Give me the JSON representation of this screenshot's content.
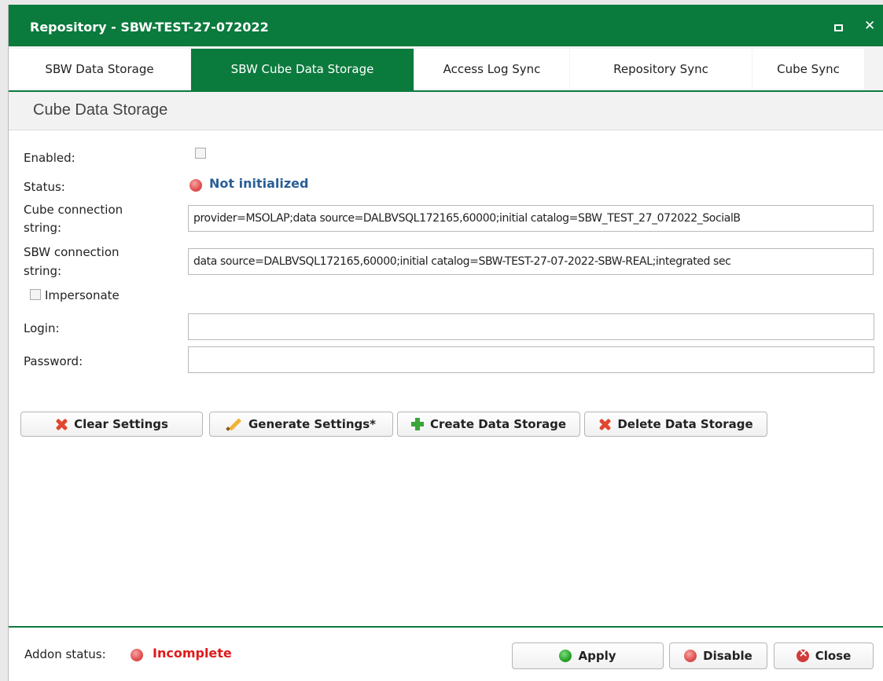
{
  "window": {
    "title": "Repository - SBW-TEST-27-072022"
  },
  "tabs": [
    {
      "label": "SBW Data Storage"
    },
    {
      "label": "SBW Cube Data Storage"
    },
    {
      "label": "Access Log Sync"
    },
    {
      "label": "Repository Sync"
    },
    {
      "label": "Cube Sync"
    }
  ],
  "section": {
    "title": "Cube Data Storage"
  },
  "form": {
    "enabled_label": "Enabled:",
    "enabled_checked": false,
    "status_label": "Status:",
    "status_value": "Not initialized",
    "cube_conn_label_1": "Cube connection",
    "cube_conn_label_2": "string:",
    "cube_conn_value": "provider=MSOLAP;data source=DALBVSQL172165,60000;initial catalog=SBW_TEST_27_072022_SocialB",
    "sbw_conn_label_1": "SBW connection",
    "sbw_conn_label_2": "string:",
    "sbw_conn_value": "data source=DALBVSQL172165,60000;initial catalog=SBW-TEST-27-07-2022-SBW-REAL;integrated sec",
    "impersonate_label": "Impersonate",
    "impersonate_checked": false,
    "login_label": "Login:",
    "login_value": "",
    "password_label": "Password:",
    "password_value": ""
  },
  "actions": {
    "clear_label": "Clear Settings",
    "generate_label": "Generate Settings*",
    "create_label": "Create Data Storage",
    "delete_label": "Delete Data Storage"
  },
  "footer": {
    "addon_label": "Addon status:",
    "addon_value": "Incomplete",
    "apply_label": "Apply",
    "disable_label": "Disable",
    "close_label": "Close"
  },
  "colors": {
    "brand_green": "#0b7a3d",
    "status_blue": "#2a5f96",
    "error_red": "#e01b1b"
  },
  "icons": {
    "clear": "red-x-icon",
    "generate": "pencil-icon",
    "create": "green-plus-icon",
    "delete": "red-x-icon",
    "apply": "green-dot-icon",
    "disable": "red-dot-icon",
    "close": "close-circle-icon"
  }
}
